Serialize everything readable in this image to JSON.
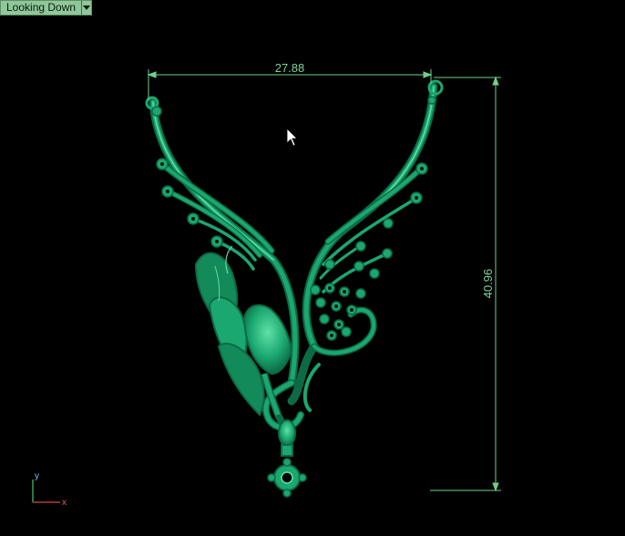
{
  "viewport": {
    "view_name": "Looking Down"
  },
  "dimensions": {
    "width_value": "27.88",
    "height_value": "40.96"
  },
  "axes": {
    "y_label": "y",
    "x_label": "x"
  },
  "colors": {
    "model": "#1aa870",
    "model_dark": "#0c6b45",
    "model_light": "#5fe0a8",
    "dimension": "#6fcf8c",
    "background": "#000000"
  }
}
